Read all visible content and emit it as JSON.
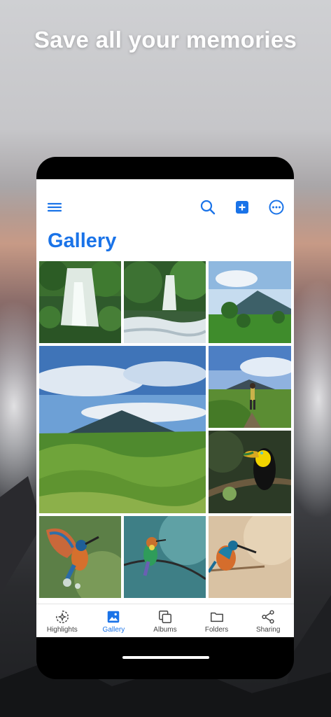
{
  "headline": "Save all your memories",
  "app": {
    "title": "Gallery",
    "toolbar": {
      "menu_icon": "hamburger-icon",
      "search_icon": "search-icon",
      "add_icon": "plus-square-icon",
      "more_icon": "more-horizontal-circle-icon"
    },
    "accent_color": "#1a73e8",
    "photos": [
      {
        "subject": "waterfall"
      },
      {
        "subject": "river-cascade"
      },
      {
        "subject": "volcano-meadow"
      },
      {
        "subject": "volcano-green-hills"
      },
      {
        "subject": "hiker-volcano"
      },
      {
        "subject": "toucan"
      },
      {
        "subject": "kingfisher-splash"
      },
      {
        "subject": "bee-eater"
      },
      {
        "subject": "kingfisher-perched"
      }
    ],
    "nav": [
      {
        "label": "Highlights",
        "icon": "sparkle-circle-icon",
        "active": false
      },
      {
        "label": "Gallery",
        "icon": "image-icon",
        "active": true
      },
      {
        "label": "Albums",
        "icon": "albums-stack-icon",
        "active": false
      },
      {
        "label": "Folders",
        "icon": "folder-icon",
        "active": false
      },
      {
        "label": "Sharing",
        "icon": "share-icon",
        "active": false
      }
    ]
  }
}
